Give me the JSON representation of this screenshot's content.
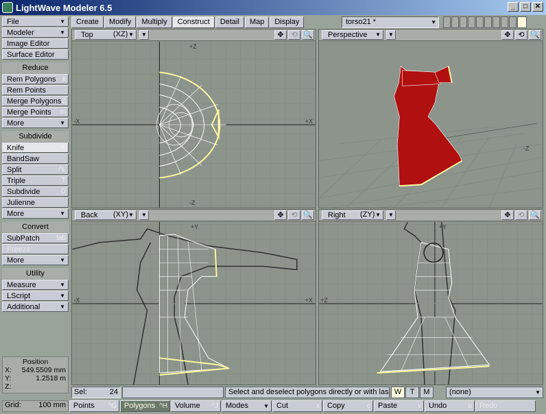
{
  "window": {
    "title": "LightWave Modeler 6.5",
    "buttons": [
      "_",
      "□",
      "✕"
    ]
  },
  "sidebar": {
    "top": [
      {
        "label": "File",
        "dropdown": true
      },
      {
        "label": "Modeler",
        "dropdown": true
      },
      {
        "label": "Image Editor"
      },
      {
        "label": "Surface Editor"
      }
    ],
    "groups": [
      {
        "header": "Reduce",
        "items": [
          {
            "label": "Rem Polygons",
            "key": "k"
          },
          {
            "label": "Rem Points",
            "key": ""
          },
          {
            "label": "Merge Polygons",
            "key": "Z"
          },
          {
            "label": "Merge Points",
            "key": "m"
          },
          {
            "label": "More",
            "dropdown": true
          }
        ]
      },
      {
        "header": "Subdivide",
        "items": [
          {
            "label": "Knife",
            "key": "K"
          },
          {
            "label": "BandSaw",
            "key": ""
          },
          {
            "label": "Split",
            "key": "^L"
          },
          {
            "label": "Triple",
            "key": "T"
          },
          {
            "label": "Subdivide",
            "key": "D"
          },
          {
            "label": "Julienne",
            "key": ""
          },
          {
            "label": "More",
            "dropdown": true
          }
        ]
      },
      {
        "header": "Convert",
        "items": [
          {
            "label": "SubPatch",
            "key": "tab"
          },
          {
            "label": "Freeze",
            "key": "",
            "disabled": true
          },
          {
            "label": "More",
            "dropdown": true
          }
        ]
      },
      {
        "header": "Utility",
        "items": [
          {
            "label": "Measure",
            "dropdown": true
          },
          {
            "label": "LScript",
            "dropdown": true
          },
          {
            "label": "Additional",
            "dropdown": true
          }
        ]
      }
    ]
  },
  "position": {
    "title": "Position",
    "x_label": "X:",
    "x": "549.5509 mm",
    "y_label": "Y:",
    "y": "1.2518 m",
    "z_label": "Z:",
    "z": ""
  },
  "tabs": [
    "Create",
    "Modify",
    "Multiply",
    "Construct",
    "Detail",
    "Map",
    "Display"
  ],
  "active_tab": "Construct",
  "layer_select": "torso21 *",
  "viewports": {
    "top": {
      "name": "Top",
      "axis": "(XZ)",
      "labels": {
        "top": "+Z",
        "left": "-X",
        "right": "+X",
        "bottom": "-Z"
      }
    },
    "perspective": {
      "name": "Perspective",
      "labels": {
        "right": "-Z"
      }
    },
    "back": {
      "name": "Back",
      "axis": "(XY)",
      "labels": {
        "top": "+Y",
        "left": "-X",
        "right": "+X"
      }
    },
    "right": {
      "name": "Right",
      "axis": "(ZY)",
      "labels": {
        "top": "+Y",
        "left": "+Z"
      }
    }
  },
  "icons": {
    "move": "✥",
    "rotate": "⟲",
    "zoom": "🔍"
  },
  "status": {
    "sel_label": "Sel:",
    "sel_value": "24",
    "message": "Select and deselect polygons directly or with las...",
    "wtm": [
      "W",
      "T",
      "M"
    ],
    "surface": "(none)"
  },
  "bottombar": {
    "grid_label": "Grid:",
    "grid_value": "100 mm",
    "modes": [
      {
        "label": "Points",
        "key": "^G"
      },
      {
        "label": "Polygons",
        "key": "^H",
        "active": true
      },
      {
        "label": "Volume",
        "key": "^J"
      }
    ],
    "modes_menu": "Modes",
    "actions": [
      {
        "label": "Cut",
        "key": "x"
      },
      {
        "label": "Copy",
        "key": "c"
      },
      {
        "label": "Paste",
        "key": "v"
      },
      {
        "label": "Undo",
        "key": "u"
      },
      {
        "label": "Redo",
        "key": "",
        "disabled": true
      }
    ]
  },
  "colors": {
    "mesh_body": "#b01010",
    "wire": "#ffffff",
    "selection": "#fff7a0",
    "grid": "#7f877f",
    "viewport_bg": "#8c948c"
  }
}
